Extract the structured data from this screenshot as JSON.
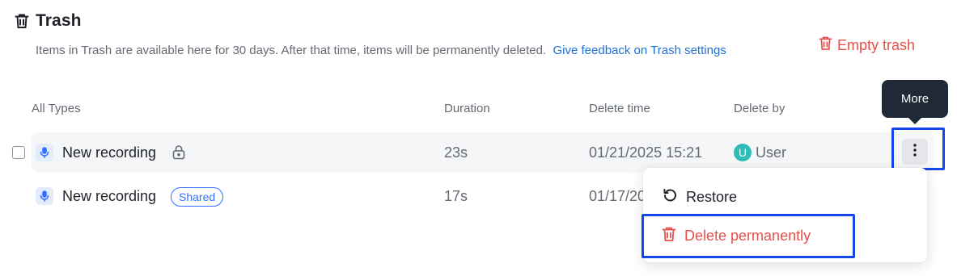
{
  "page": {
    "title": "Trash",
    "description": "Items in Trash are available here for 30 days. After that time, items will be permanently deleted.",
    "feedback_link": "Give feedback on Trash settings",
    "empty_trash_label": "Empty trash"
  },
  "columns": {
    "type": "All Types",
    "duration": "Duration",
    "delete_time": "Delete time",
    "delete_by": "Delete by"
  },
  "rows": [
    {
      "name": "New recording",
      "locked": true,
      "duration": "23s",
      "delete_time": "01/21/2025 15:21",
      "delete_by": "User",
      "avatar_letter": "U"
    },
    {
      "name": "New recording",
      "badge": "Shared",
      "duration": "17s",
      "delete_time": "01/17/20"
    }
  ],
  "tooltip": {
    "label": "More"
  },
  "menu": {
    "restore_label": "Restore",
    "delete_label": "Delete permanently"
  },
  "colors": {
    "accent": "#1e6fd9",
    "danger": "#e5504b",
    "highlight": "#1447e6",
    "avatar": "#2fbcb6"
  },
  "icons": [
    "trash-icon",
    "recording-icon",
    "lock-icon",
    "more-vertical-icon",
    "restore-icon",
    "delete-icon"
  ]
}
